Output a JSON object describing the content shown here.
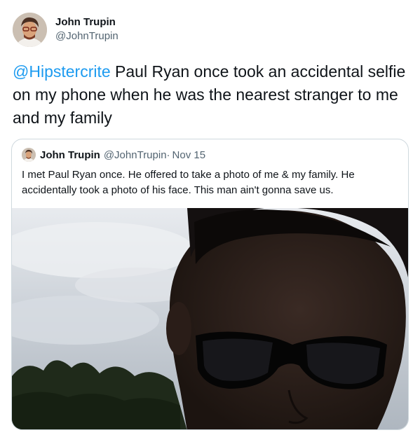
{
  "tweet": {
    "author": {
      "display_name": "John Trupin",
      "handle": "@JohnTrupin",
      "avatar_icon": "profile-photo"
    },
    "mention": "@Hipstercrite",
    "body": " Paul Ryan once took an accidental selfie on my phone when he was the nearest stranger to me and my family",
    "link_color": "#1d9bf0"
  },
  "quoted_tweet": {
    "author": {
      "display_name": "John Trupin",
      "handle": "@JohnTrupin",
      "avatar_icon": "profile-photo"
    },
    "separator": "·",
    "date": "Nov 15",
    "text": "I met Paul Ryan once. He offered to take a photo of me & my family. He accidentally took a photo of his face. This man ain't gonna save us.",
    "media_icon": "photo-of-face-selfie"
  }
}
